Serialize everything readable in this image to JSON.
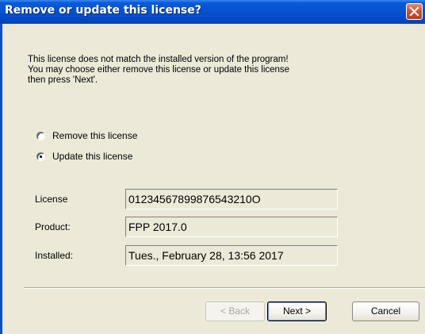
{
  "window": {
    "title": "Remove or update this license?"
  },
  "message": {
    "lines": [
      "This license does not match the installed version of the program!",
      "You may choose either remove this license or update this license",
      "then press 'Next'."
    ]
  },
  "options": [
    {
      "label": "Remove this license",
      "selected": false
    },
    {
      "label": "Update this license",
      "selected": true
    }
  ],
  "fields": {
    "license": {
      "label": "License",
      "value": "01234567899876543210O"
    },
    "product": {
      "label": "Product:",
      "value": "FPP 2017.0"
    },
    "installed": {
      "label": "Installed:",
      "value": "Tues., February 28, 13:56 2017"
    }
  },
  "buttons": {
    "back": "< Back",
    "next": "Next >",
    "cancel": "Cancel"
  },
  "colors": {
    "titlebar": "#0451d2",
    "close_button": "#d4532e",
    "dialog_background": "#ece9d8"
  },
  "icons": {
    "close": "close-x-icon"
  }
}
